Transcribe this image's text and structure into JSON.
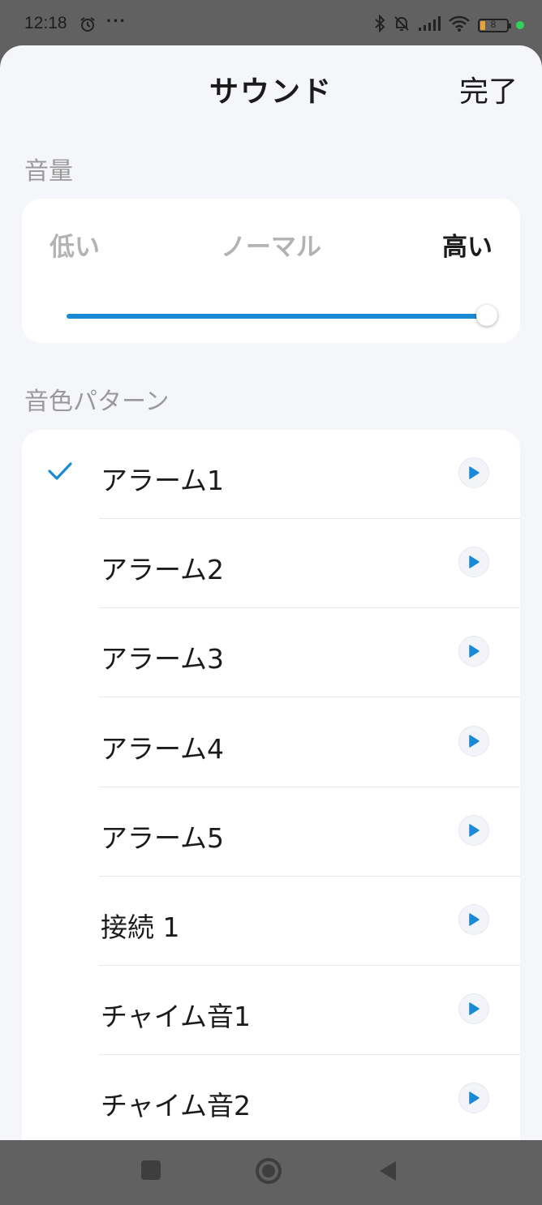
{
  "status_bar": {
    "time": "12:18",
    "more": "···",
    "battery_level": "8",
    "icons": [
      "alarm-clock-icon",
      "bluetooth-icon",
      "silent-bell-icon",
      "signal-icon",
      "wifi-icon",
      "battery-icon",
      "privacy-dot-icon"
    ]
  },
  "header": {
    "title": "サウンド",
    "done_label": "完了"
  },
  "volume": {
    "section_label": "音量",
    "low_label": "低い",
    "normal_label": "ノーマル",
    "high_label": "高い",
    "level_percent": 100,
    "accent_color": "#1a8ad6"
  },
  "tones": {
    "section_label": "音色パターン",
    "selected_index": 0,
    "items": [
      {
        "label": "アラーム1"
      },
      {
        "label": "アラーム2"
      },
      {
        "label": "アラーム3"
      },
      {
        "label": "アラーム4"
      },
      {
        "label": "アラーム5"
      },
      {
        "label": "接続 1"
      },
      {
        "label": "チャイム音1"
      },
      {
        "label": "チャイム音2"
      }
    ]
  },
  "nav_bar": {
    "icons": [
      "recents-square-icon",
      "home-circle-icon",
      "back-triangle-icon"
    ]
  }
}
